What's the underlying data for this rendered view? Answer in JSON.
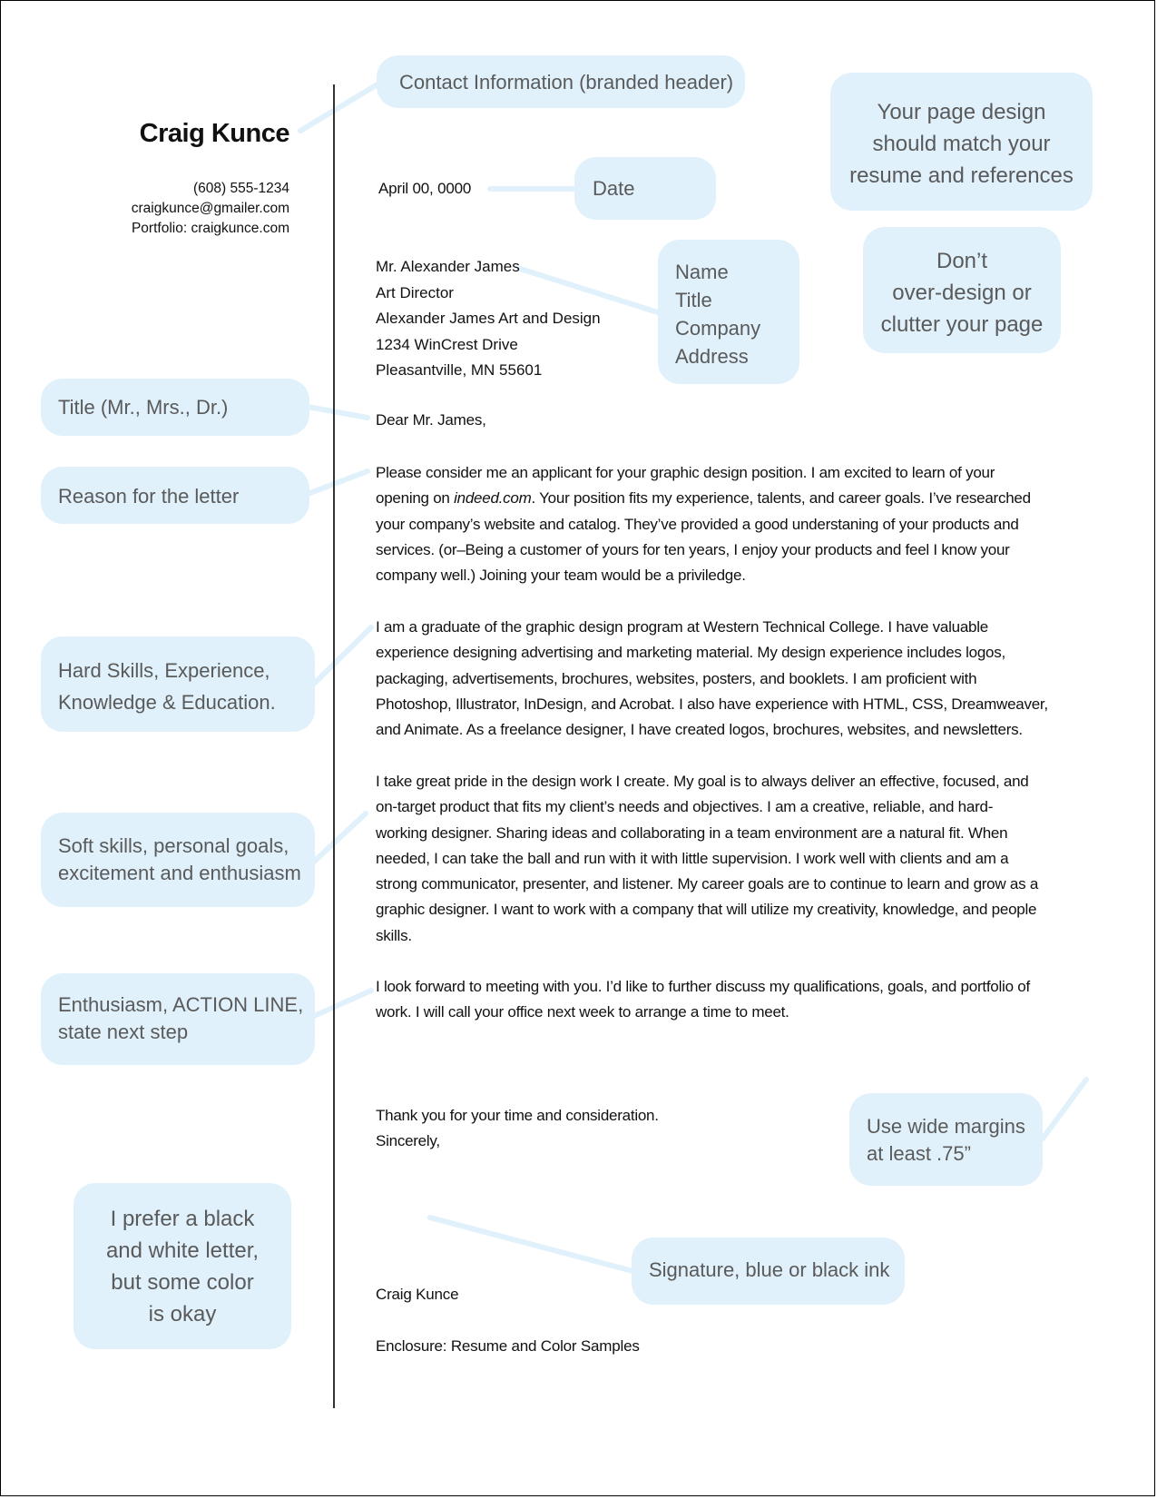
{
  "header": {
    "name": "Craig Kunce",
    "phone": "(608) 555-1234",
    "email": "craigkunce@gmailer.com",
    "portfolio": "Portfolio: craigkunce.com"
  },
  "letter": {
    "date": "April 00, 0000",
    "recipient": [
      "Mr. Alexander James",
      "Art Director",
      "Alexander James Art and Design",
      "1234 WinCrest Drive",
      "Pleasantville, MN 55601"
    ],
    "salutation": "Dear Mr. James,",
    "paragraph1": {
      "line1": "Please consider me an applicant for your graphic design position. I am excited to learn of your",
      "line2_pre": "opening on ",
      "line2_italic": "indeed.com",
      "line2_post": ". Your position fits my experience, talents, and career goals. I’ve researched",
      "line3": "your company’s website and catalog. They’ve provided a good understaning of your products and",
      "line4": "services. (or–Being a customer of yours for ten years, I enjoy your products and feel I know your",
      "line5": "company well.) Joining your team would be a priviledge."
    },
    "paragraph2": [
      "I am a graduate of the graphic design program at Western Technical College. I have valuable",
      "experience designing advertising and marketing material. My design experience includes logos,",
      "packaging, advertisements, brochures, websites, posters, and booklets. I am proficient with",
      "Photoshop, Illustrator, InDesign, and Acrobat. I also have experience with HTML, CSS, Dreamweaver,",
      "and Animate. As a freelance designer, I have created logos, brochures, websites, and newsletters."
    ],
    "paragraph3": [
      "I take great pride in the design work I create. My goal is to always deliver an effective, focused, and",
      "on-target product that fits my client’s needs and objectives. I am a creative, reliable, and hard-",
      "working designer. Sharing ideas and collaborating in a team environment are a natural fit. When",
      "needed, I can take the ball and run with it with little supervision. I work well with clients and am a",
      "strong communicator, presenter, and listener. My career goals are to continue to learn and grow as a",
      "graphic designer. I want to work with a company that will utilize my creativity, knowledge, and people",
      "skills."
    ],
    "paragraph4": [
      "I look forward to meeting with you. I’d like to further discuss my qualifications, goals, and portfolio of",
      "work. I will call your office next week to arrange a time to meet."
    ],
    "closing_thanks": "Thank you for your time and consideration.",
    "closing": "Sincerely,",
    "signature_name": "Craig Kunce",
    "enclosure": "Enclosure: Resume and Color Samples"
  },
  "callouts": {
    "contact": [
      "Contact Information (branded header)"
    ],
    "design_match": [
      "Your page design",
      "should match your",
      "resume and references"
    ],
    "date": [
      "Date"
    ],
    "dont_overdesign": [
      "Don’t",
      "over-design or",
      "clutter your page"
    ],
    "inside_address": [
      "Name",
      "Title",
      "Company",
      "Address"
    ],
    "title": [
      "Title (Mr., Mrs., Dr.)"
    ],
    "reason": [
      "Reason for the letter"
    ],
    "hard_skills": [
      "Hard Skills, Experience,",
      "Knowledge & Education."
    ],
    "soft_skills": [
      "Soft skills, personal goals,",
      "excitement and enthusiasm"
    ],
    "action": [
      "Enthusiasm, ACTION LINE,",
      "state next step"
    ],
    "margins": [
      "Use wide margins",
      "at least .75”"
    ],
    "color": [
      "I prefer a black",
      "and white letter,",
      "but some color",
      "is okay"
    ],
    "signature": [
      "Signature, blue or black ink"
    ]
  },
  "colors": {
    "callout_bg": "#e0f1fb",
    "callout_text": "#5a5a5a",
    "body_text": "#111111"
  }
}
